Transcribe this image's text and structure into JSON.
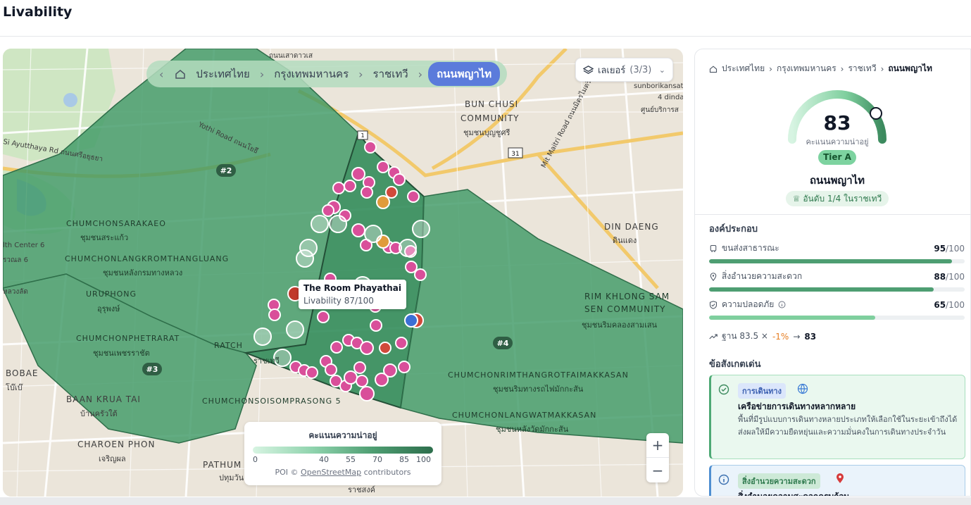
{
  "app": {
    "title": "Livability"
  },
  "map": {
    "breadcrumb": {
      "items": [
        "ประเทศไทย",
        "กรุงเทพมหานคร",
        "ราชเทวี"
      ],
      "active": "ถนนพญาไท"
    },
    "layers": {
      "label": "เลเยอร์",
      "count": "(3/3)"
    },
    "labels": {
      "bun_chusi": "BUN CHUSI",
      "community": "COMMUNITY",
      "bun_chusi_th": "ชุมชนบุญชูศรี",
      "din_daeng": "DIN DAENG",
      "din_daeng_th": "ดินแดง",
      "chumchonsarakaeo": "CHUMCHONSARAKAEO",
      "chumchonsarakaeo_th": "ชุมชนสระแก้ว",
      "langkrom": "CHUMCHONLANGKROMTHANGLUANG",
      "langkrom_th": "ชุมชนหลังกรมทางหลวง",
      "uruphong": "URUPHONG",
      "uruphong_th": "อุรุพงษ์",
      "phetrarat": "CHUMCHONPHETRARAT",
      "phetrarat_th": "ชุมชนเพชรราชัต",
      "ratchathewi_frag": "RATCH",
      "bobae": "BOBAE",
      "bobae_th": "โบ๊เบ๊",
      "baan_krua": "BAAN KRUA TAI",
      "baan_krua_th": "บ้านครัวใต้",
      "charoen_phon": "CHAROEN PHON",
      "charoen_phon_th": "เจริญผล",
      "pathum": "PATHUM",
      "pathum_th": "ปทุมวัน",
      "soi_somprasong": "CHUMCHONSOISOMPRASONG 5",
      "rim_khlong": "RIM KHLONG SAM",
      "sen_community": "SEN COMMUNITY",
      "rim_khlong_th": "ชุมชนริมคลองสามเสน",
      "rimthangrot": "CHUMCHONRIMTHANGROTFAIMAKKASAN",
      "rimthangrot_th": "ชุมชนริมทางรถไฟมักกะสัน",
      "langwat": "CHUMCHONLANGWATMAKKASAN",
      "langwat_th": "ชุมชนหลังวัดมักกะสัน",
      "health_center": "lth Center 6",
      "si_ayutthaya": "Si Ayutthaya Rd ถนนศรีอยุธยา",
      "yothi_road": "Yothi Road ถนนโยธี",
      "mit_maitri": "Mit Maitri Road ถนนมิตรไมตรี",
      "sunbori": "sunborikansat",
      "dindaeng4": "4 dinda",
      "service_center": "ศูนย์บริการส",
      "road_31": "31",
      "road_1": "1",
      "ratchasong": "ราชสงค์",
      "top_frag": "ถนนเสาดาวเส",
      "ratchawithi_frag": "ราชเทวี",
      "tesalak": "รวณล 6",
      "sanluang": "หลวงลัด"
    },
    "zones": [
      "#2",
      "#3",
      "#4"
    ],
    "tooltip": {
      "title": "The Room Phayathai",
      "subtitle": "Livability 87/100"
    },
    "legend": {
      "title": "คะแนนความน่าอยู่",
      "ticks": [
        "0",
        "40",
        "55",
        "70",
        "85",
        "100"
      ],
      "credit_prefix": "POI ©",
      "credit_link": "OpenStreetMap",
      "credit_suffix": "contributors"
    },
    "zoom": {
      "in": "+",
      "out": "−"
    }
  },
  "panel": {
    "breadcrumb": [
      "ประเทศไทย",
      "กรุงเทพมหานคร",
      "ราชเทวี"
    ],
    "breadcrumb_current": "ถนนพญาไท",
    "score": 83,
    "score_caption": "คะแนนความน่าอยู่",
    "tier": "Tier A",
    "area_name": "ถนนพญาไท",
    "rank": "อันดับ 1/4 ในราชเทวี",
    "components_title": "องค์ประกอบ",
    "components": [
      {
        "name": "ขนส่งสาธารณะ",
        "value": "95",
        "denominator": "/100",
        "score": 95,
        "color": "#4e9e72",
        "icon": "bus-icon"
      },
      {
        "name": "สิ่งอำนวยความสะดวก",
        "value": "88",
        "denominator": "/100",
        "score": 88,
        "color": "#4e9e72",
        "icon": "pin-icon"
      },
      {
        "name": "ความปลอดภัย",
        "value": "65",
        "denominator": "/100",
        "score": 65,
        "color": "#7fcf9e",
        "icon": "shield-icon"
      }
    ],
    "formula": {
      "prefix": "ฐาน 83.5 ×",
      "delta": "-1%",
      "arrow": "→",
      "result": "83"
    },
    "observations_title": "ข้อสังเกตเด่น",
    "observations": [
      {
        "tag": "การเดินทาง",
        "title": "เครือข่ายการเดินทางหลากหลาย",
        "body": "พื้นที่มีรูปแบบการเดินทางหลายประเภทให้เลือกใช้ในระยะเข้าถึงได้ ส่งผลให้มีความยืดหยุ่นและความมั่นคงในการเดินทางประจำวัน"
      },
      {
        "tag": "สิ่งอำนวยความสะดวก",
        "title": "สิ่งอำนวยความสะดวกครบถ้วน",
        "body": ""
      }
    ],
    "colors": {
      "accent": "#4e9e72",
      "tier": "#7dd3a0",
      "active_breadcrumb": "#5b7bdb"
    }
  }
}
